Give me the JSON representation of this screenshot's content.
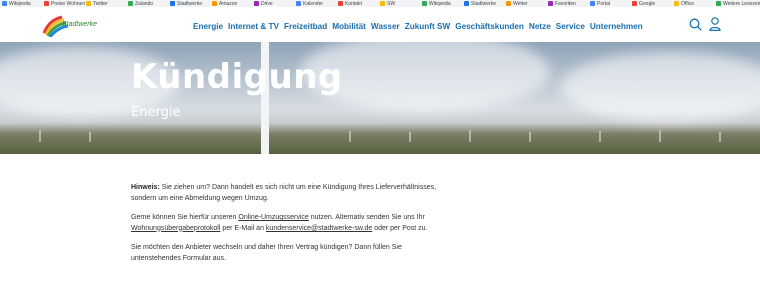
{
  "bookmarks": [
    "Wikipedia",
    "Preise Wohnen",
    "Twitter",
    "Zalando",
    "Stadtwerke",
    "Amazon",
    "Drive",
    "Kalender",
    "Kontakt",
    "SW",
    "Wikipedia",
    "Stadtwerke",
    "Wetter",
    "Favoriten",
    "Portal",
    "Google",
    "Office",
    "Weitere Lesezeichen"
  ],
  "header": {
    "logo_text": "Stadtwerke",
    "nav": [
      "Energie",
      "Internet & TV",
      "Freizeitbad",
      "Mobilität",
      "Wasser",
      "Zukunft SW",
      "Geschäftskunden",
      "Netze",
      "Service",
      "Unternehmen"
    ]
  },
  "hero": {
    "title": "Kündigung",
    "subtitle": "Energie"
  },
  "content": {
    "p1_label": "Hinweis:",
    "p1_text1": " Sie ziehen um? Dann handelt es sich nicht um eine Kündigung Ihres Lieferverhältnisses,",
    "p1_text2": "sondern um eine Abmeldung wegen Umzug.",
    "p2_text1": "Gerne können Sie hierfür unseren ",
    "p2_link1": "Online-Umzugsservice",
    "p2_text2": " nutzen. Alternativ senden Sie uns Ihr",
    "p2_link2": "Wohnungsübergabeprotokoll",
    "p2_text3": " per E-Mail an ",
    "p2_link3": "kundenservice@stadtwerke-sw.de",
    "p2_text4": " oder per Post zu.",
    "p3_text1": "Sie möchten den Anbieter wechseln und daher Ihren Vertrag kündigen? Dann füllen Sie",
    "p3_text2": "untenstehendes Formular aus."
  },
  "colors": {
    "nav": "#1a6fb0",
    "text": "#333333"
  }
}
